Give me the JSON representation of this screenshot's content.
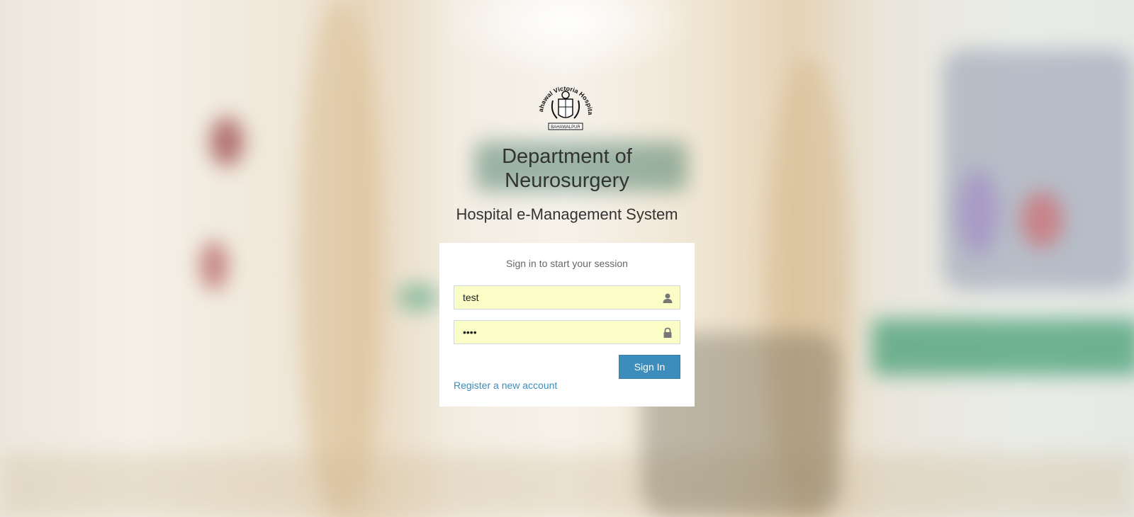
{
  "logo": {
    "ring_text": "Bahawal Victoria Hospital",
    "banner_text": "BAHAWALPUR"
  },
  "header": {
    "dept_line1": "Department of",
    "dept_line2": "Neurosurgery",
    "system_name": "Hospital e-Management System"
  },
  "login": {
    "message": "Sign in to start your session",
    "username_value": "test",
    "password_value": "••••",
    "signin_label": "Sign In",
    "register_label": "Register a new account"
  },
  "colors": {
    "primary": "#3c8dbc",
    "autofill": "#fbfdc6"
  },
  "icons": {
    "username": "user-icon",
    "password": "lock-icon"
  }
}
